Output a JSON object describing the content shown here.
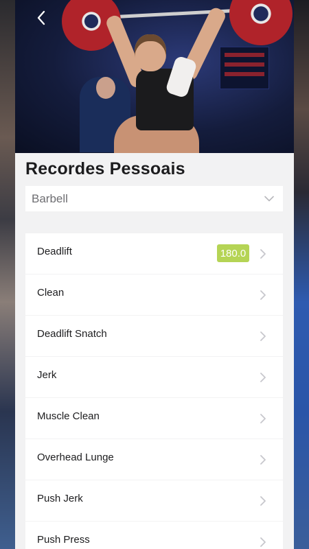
{
  "header": {
    "back_icon": "chevron-left-icon",
    "hero_image": "weightlifter-photo"
  },
  "page_title": "Recordes Pessoais",
  "category_select": {
    "value": "Barbell",
    "icon": "chevron-down-icon"
  },
  "records": [
    {
      "label": "Deadlift",
      "value": "180.0"
    },
    {
      "label": "Clean",
      "value": null
    },
    {
      "label": "Deadlift Snatch",
      "value": null
    },
    {
      "label": "Jerk",
      "value": null
    },
    {
      "label": "Muscle Clean",
      "value": null
    },
    {
      "label": "Overhead Lunge",
      "value": null
    },
    {
      "label": "Push Jerk",
      "value": null
    },
    {
      "label": "Push Press",
      "value": null
    }
  ],
  "colors": {
    "badge": "#b5d455",
    "background": "#f2f2f3",
    "text": "#1c1c1e",
    "muted": "#6e6e72"
  }
}
